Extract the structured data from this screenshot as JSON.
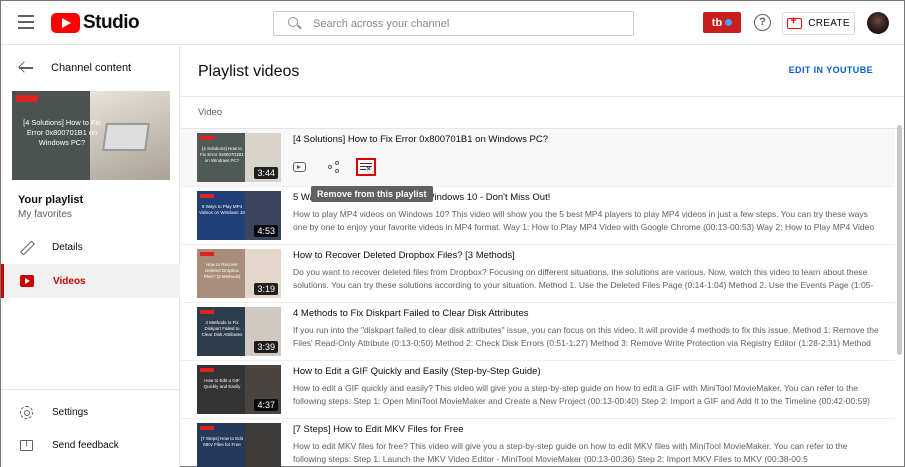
{
  "header": {
    "logo_text": "Studio",
    "search_placeholder": "Search across your channel",
    "extension_label": "tb",
    "help_label": "?",
    "create_label": "CREATE"
  },
  "sidebar": {
    "back_label": "Channel content",
    "playlist_thumb_text": "[4 Solutions] How to Fix Error 0x800701B1 on Windows PC?",
    "playlist_title": "Your playlist",
    "playlist_subtitle": "My favorites",
    "items": [
      {
        "label": "Details"
      },
      {
        "label": "Videos"
      }
    ],
    "settings_label": "Settings",
    "feedback_label": "Send feedback",
    "feedback_icon_glyph": "!"
  },
  "main": {
    "title": "Playlist videos",
    "edit_link": "EDIT IN YOUTUBE",
    "column_header": "Video",
    "tooltip": "Remove from this playlist",
    "videos": [
      {
        "title": "[4 Solutions] How to Fix Error 0x800701B1 on Windows PC?",
        "description": "",
        "duration": "3:44",
        "thumb_text": "[4 Solutions] How to Fix Error 0x800701B1 on Windows PC?",
        "thumb_left": "#4f5a56",
        "thumb_right": "#d8d3cb"
      },
      {
        "title": "5 Ways to Play MP4 Videos on Windows 10 - Don't Miss Out!",
        "description": "How to play MP4 videos on Windows 10? This video will show you the 5 best MP4 players to play MP4 videos in just a few steps. You can try these ways one by one to enjoy your favorite videos in MP4 format. Way 1: How to Play MP4 Video with Google Chrome (00:13-00:53) Way 2: How to Play MP4 Video",
        "duration": "4:53",
        "thumb_text": "5 Ways to Play MP4 Videos on Windows 10",
        "thumb_left": "#1f3f77",
        "thumb_right": "#3a4660"
      },
      {
        "title": "How to Recover Deleted Dropbox Files? [3 Methods]",
        "description": "Do you want to recover deleted files from Dropbox? Focusing on different situations, the solutions are various. Now, watch this video to learn about these solutions. You can try these solutions according to your situation. Method 1. Use the Deleted Files Page (0:14-1:04) Method 2. Use the Events Page (1:05-",
        "duration": "3:19",
        "thumb_text": "How to Recover Deleted Dropbox Files? [3 Methods]",
        "thumb_left": "#a88d7b",
        "thumb_right": "#e3d7cc"
      },
      {
        "title": "4 Methods to Fix Diskpart Failed to Clear Disk Attributes",
        "description": "If you run into the \"diskpart failed to clear disk attributes\" issue, you can focus on this video. It will provide 4 methods to fix this issue. Method 1: Remove the Files' Read-Only Attribute (0:13-0:50) Method 2: Check Disk Errors (0:51-1:27) Method 3: Remove Write Protection via Registry Editor (1:28-2:31) Method",
        "duration": "3:39",
        "thumb_text": "4 Methods to Fix Diskpart Failed to Clear Disk Attributes",
        "thumb_left": "#2c3d4d",
        "thumb_right": "#cfc9c1"
      },
      {
        "title": "How to Edit a GIF Quickly and Easily (Step-by-Step Guide)",
        "description": "How to edit a GIF quickly and easily? This video will give you a step-by-step guide on how to edit a GIF with MiniTool MovieMaker. You can refer to the following steps: Step 1: Open MiniTool MovieMaker and Create a New Project (00:13-00:40) Step 2: Import a GIF and Add It to the Timeline (00:42-00:59)",
        "duration": "4:37",
        "thumb_text": "How to Edit a GIF Quickly and Easily",
        "thumb_left": "#343434",
        "thumb_right": "#4a4440"
      },
      {
        "title": "[7 Steps] How to Edit MKV Files for Free",
        "description": "How to edit MKV files for free? This video will give you a step-by-step guide on how to edit MKV files with MiniTool MovieMaker. You can refer to the following steps: Step 1: Launch the MKV Video Editor - MiniTool MovieMaker (00:13-00:36) Step 2: Import MKV Files to MKV (00:38-00:5",
        "duration": "",
        "thumb_text": "[7 Steps] How to Edit MKV Files for Free",
        "thumb_left": "#253a5a",
        "thumb_right": "#3d3a37"
      }
    ]
  }
}
